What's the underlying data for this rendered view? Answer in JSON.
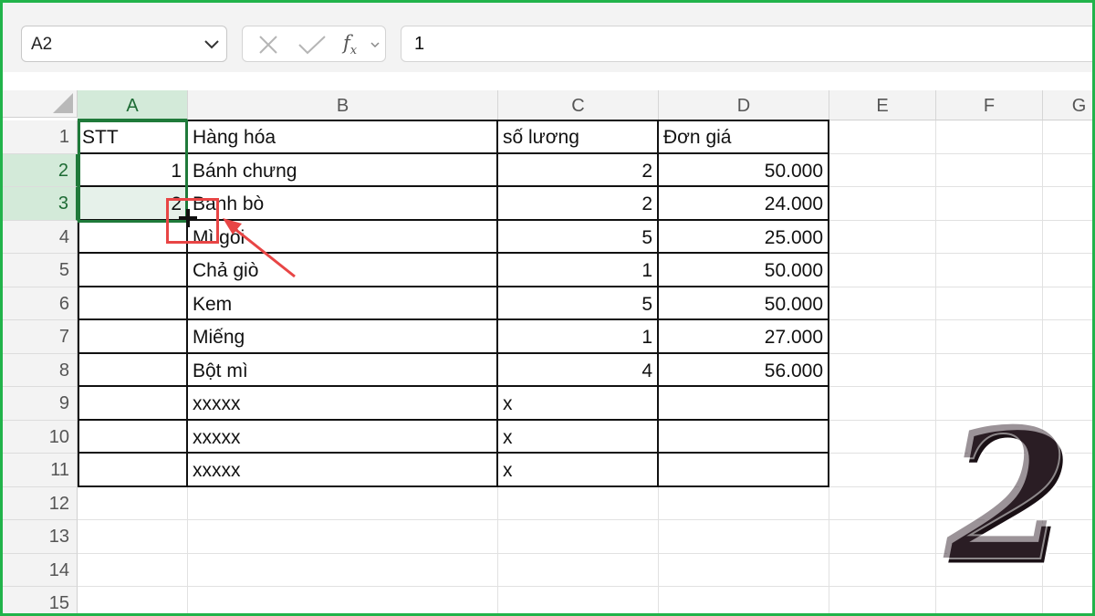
{
  "toolbar": {
    "name_box": "A2",
    "fx_label": "f",
    "fx_sub": "x",
    "formula_value": "1",
    "icons": [
      "chevron-down-icon",
      "cancel-x-icon",
      "enter-check-icon",
      "function-fx-icon"
    ]
  },
  "columns": [
    "A",
    "B",
    "C",
    "D",
    "E",
    "F",
    "G"
  ],
  "rows": [
    "1",
    "2",
    "3",
    "4",
    "5",
    "6",
    "7",
    "8",
    "9",
    "10",
    "11",
    "12",
    "13",
    "14",
    "15"
  ],
  "table": {
    "header": [
      "STT",
      "Hàng hóa",
      "số lương",
      "Đơn giá"
    ],
    "records": [
      {
        "stt": "1",
        "item": "Bánh chưng",
        "qty": "2",
        "price": "50.000"
      },
      {
        "stt": "2",
        "item": "Banh bò",
        "qty": "2",
        "price": "24.000"
      },
      {
        "stt": "",
        "item": "Mì gói",
        "qty": "5",
        "price": "25.000"
      },
      {
        "stt": "",
        "item": "Chả giò",
        "qty": "1",
        "price": "50.000"
      },
      {
        "stt": "",
        "item": "Kem",
        "qty": "5",
        "price": "50.000"
      },
      {
        "stt": "",
        "item": "Miếng",
        "qty": "1",
        "price": "27.000"
      },
      {
        "stt": "",
        "item": "Bột mì",
        "qty": "4",
        "price": "56.000"
      },
      {
        "stt": "",
        "item": "xxxxx",
        "qty": "x",
        "price": ""
      },
      {
        "stt": "",
        "item": "xxxxx",
        "qty": "x",
        "price": ""
      },
      {
        "stt": "",
        "item": "xxxxx",
        "qty": "x",
        "price": ""
      }
    ]
  },
  "overlay": {
    "step_number": "2",
    "accent_red": "#e84545",
    "select_green": "#1f7a3a",
    "frame_green": "#21b34a"
  }
}
